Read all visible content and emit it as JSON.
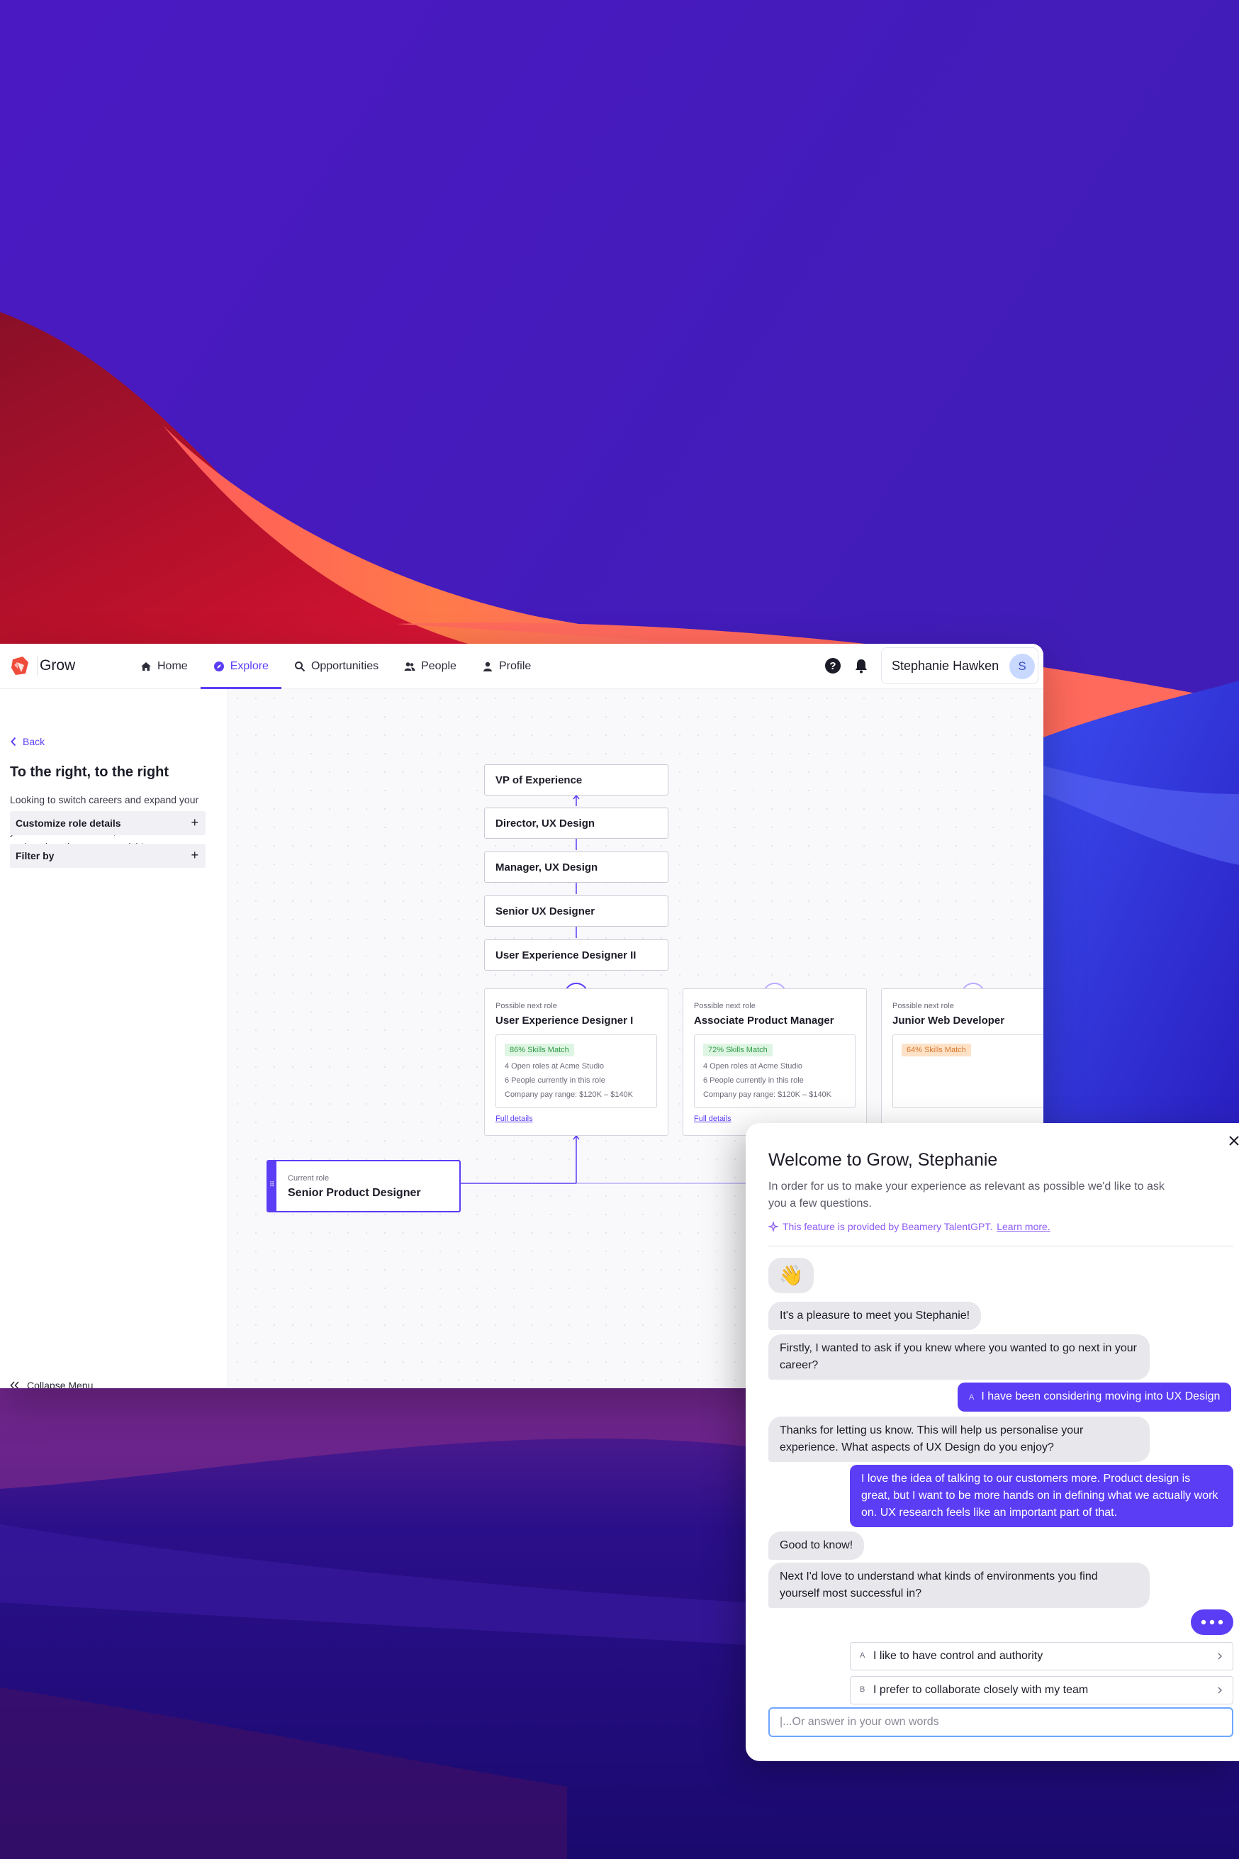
{
  "colors": {
    "accent": "#5b3df5",
    "badge_green_bg": "#dff5e3",
    "badge_green_text": "#2c9a44",
    "badge_orange_bg": "#fde2c8",
    "badge_orange_text": "#d9772a",
    "chat_feature": "#8d5bf5"
  },
  "app": {
    "name": "Grow",
    "nav": [
      {
        "label": "Home",
        "icon": "home-icon"
      },
      {
        "label": "Explore",
        "icon": "compass-icon",
        "active": true
      },
      {
        "label": "Opportunities",
        "icon": "search-icon"
      },
      {
        "label": "People",
        "icon": "people-icon"
      },
      {
        "label": "Profile",
        "icon": "person-icon"
      }
    ],
    "user": {
      "name": "Stephanie Hawken",
      "initial": "S"
    }
  },
  "sidebar": {
    "back": "Back",
    "title": "To the right, to the right",
    "description": "Looking to switch careers and expand your skillset? We've tailored these suggestions to your skills and interests, but feel free to sort and explore them as you wish!",
    "accordions": [
      "Customize role details",
      "Filter by"
    ],
    "collapse": "Collapse Menu"
  },
  "path": [
    "VP of Experience",
    "Director, UX Design",
    "Manager, UX Design",
    "Senior UX Designer",
    "User Experience Designer II"
  ],
  "next_roles": [
    {
      "kicker": "Possible next role",
      "title": "User Experience Designer I",
      "match": "86% Skills Match",
      "match_color": "green",
      "lines": [
        "4 Open roles at Acme Studio",
        "6 People currently in this role",
        "Company pay range: $120K – $140K"
      ],
      "link": "Full details"
    },
    {
      "kicker": "Possible next role",
      "title": "Associate Product Manager",
      "match": "72% Skills Match",
      "match_color": "green",
      "lines": [
        "4 Open roles at Acme Studio",
        "6 People currently in this role",
        "Company pay range: $120K – $140K"
      ],
      "link": "Full details"
    },
    {
      "kicker": "Possible next role",
      "title": "Junior Web Developer",
      "match": "64% Skills Match",
      "match_color": "orange",
      "lines": [],
      "link": ""
    }
  ],
  "current_role": {
    "kicker": "Current role",
    "title": "Senior Product Designer"
  },
  "chat": {
    "title": "Welcome to Grow, Stephanie",
    "subtitle": "In order for us to make your experience as relevant as possible we'd like to ask you a few questions.",
    "feature_text": "This feature is provided by Beamery TalentGPT.",
    "feature_link": "Learn more.",
    "wave": "👋",
    "messages": [
      {
        "from": "bot",
        "text": "It's a pleasure to meet you Stephanie!"
      },
      {
        "from": "bot",
        "text": "Firstly, I wanted to ask if you knew where you wanted to go next in your career?"
      },
      {
        "from": "user",
        "tag": "A",
        "text": "I have been considering moving into UX Design"
      },
      {
        "from": "bot",
        "text": "Thanks for letting us know.  This will help us personalise your experience. What aspects of UX Design do you enjoy?"
      },
      {
        "from": "user",
        "text": "I love the idea of talking to our customers more. Product design is great, but I want to be more hands on in defining what we actually work on. UX research feels like an important part of that."
      },
      {
        "from": "bot",
        "text": "Good to know!"
      },
      {
        "from": "bot",
        "text": "Next I'd love to understand what kinds of environments you find yourself most successful in?"
      }
    ],
    "options": [
      {
        "key": "A",
        "label": "I like to have control and authority"
      },
      {
        "key": "B",
        "label": "I prefer to collaborate closely with my team"
      }
    ],
    "input_placeholder": "|...Or answer in your own words"
  }
}
